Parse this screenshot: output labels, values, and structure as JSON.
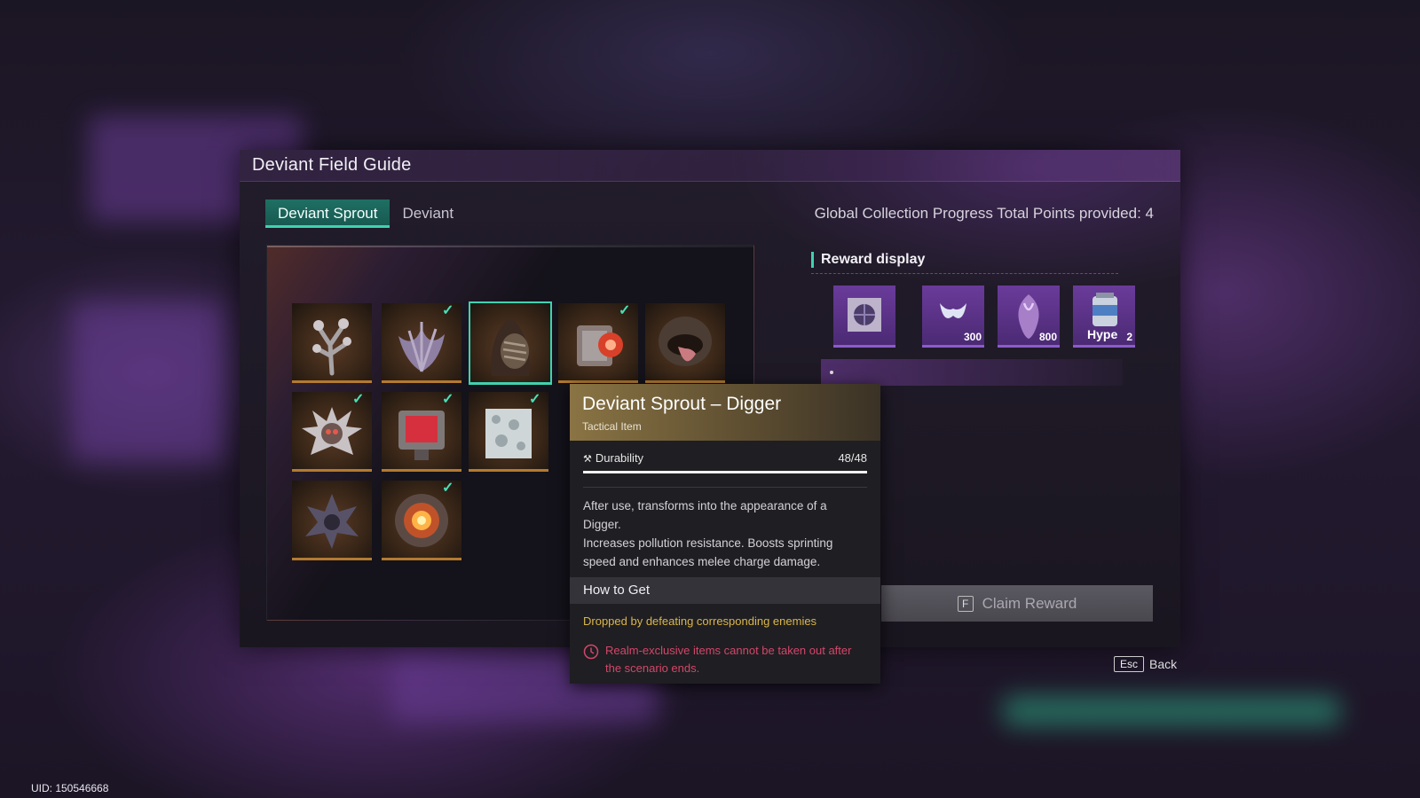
{
  "window": {
    "title": "Deviant Field Guide"
  },
  "tabs": [
    {
      "label": "Deviant Sprout",
      "active": true
    },
    {
      "label": "Deviant",
      "active": false
    }
  ],
  "progress": {
    "text": "Global Collection Progress Total Points provided: 4"
  },
  "grid": {
    "items": [
      {
        "name": "coral-crystal-deviant",
        "collected": false,
        "selected": false
      },
      {
        "name": "purple-coral-deviant",
        "collected": true,
        "selected": false
      },
      {
        "name": "digger-deviant",
        "collected": false,
        "selected": true
      },
      {
        "name": "red-eye-machine-deviant",
        "collected": true,
        "selected": false
      },
      {
        "name": "tongue-mouth-deviant",
        "collected": false,
        "selected": false
      },
      {
        "name": "spiky-skull-deviant",
        "collected": true,
        "selected": false
      },
      {
        "name": "tv-head-deviant",
        "collected": true,
        "selected": false
      },
      {
        "name": "white-cube-deviant",
        "collected": true,
        "selected": false
      },
      {
        "name": "dark-spike-deviant",
        "collected": false,
        "selected": false
      },
      {
        "name": "fire-orb-deviant",
        "collected": true,
        "selected": false
      }
    ]
  },
  "rewards": {
    "label": "Reward display",
    "items": [
      {
        "name": "crystal-orb",
        "qty": ""
      },
      {
        "name": "m-token",
        "qty": "300"
      },
      {
        "name": "purple-creature",
        "qty": "800"
      },
      {
        "name": "hype-canister",
        "label": "Hype",
        "qty": "2"
      }
    ]
  },
  "claim": {
    "key": "F",
    "label": "Claim Reward"
  },
  "tooltip": {
    "name": "Deviant Sprout – Digger",
    "type": "Tactical Item",
    "durability_label": "Durability",
    "durability_value": "48/48",
    "durability_fraction": 1.0,
    "description_line1": "After use, transforms into the appearance of a Digger.",
    "description_line2": "Increases pollution resistance. Boosts sprinting speed and enhances melee charge damage.",
    "how_to_get_title": "How to Get",
    "drop_info": "Dropped by defeating corresponding enemies",
    "warning": "Realm-exclusive items cannot be taken out after the scenario ends."
  },
  "footer": {
    "esc_key": "Esc",
    "back_label": "Back",
    "uid": "UID: 150546668"
  },
  "colors": {
    "accent": "#3fd2b0",
    "gold": "#d9b64c",
    "warning": "#d2476a",
    "reward_bg": "#5a3388"
  }
}
